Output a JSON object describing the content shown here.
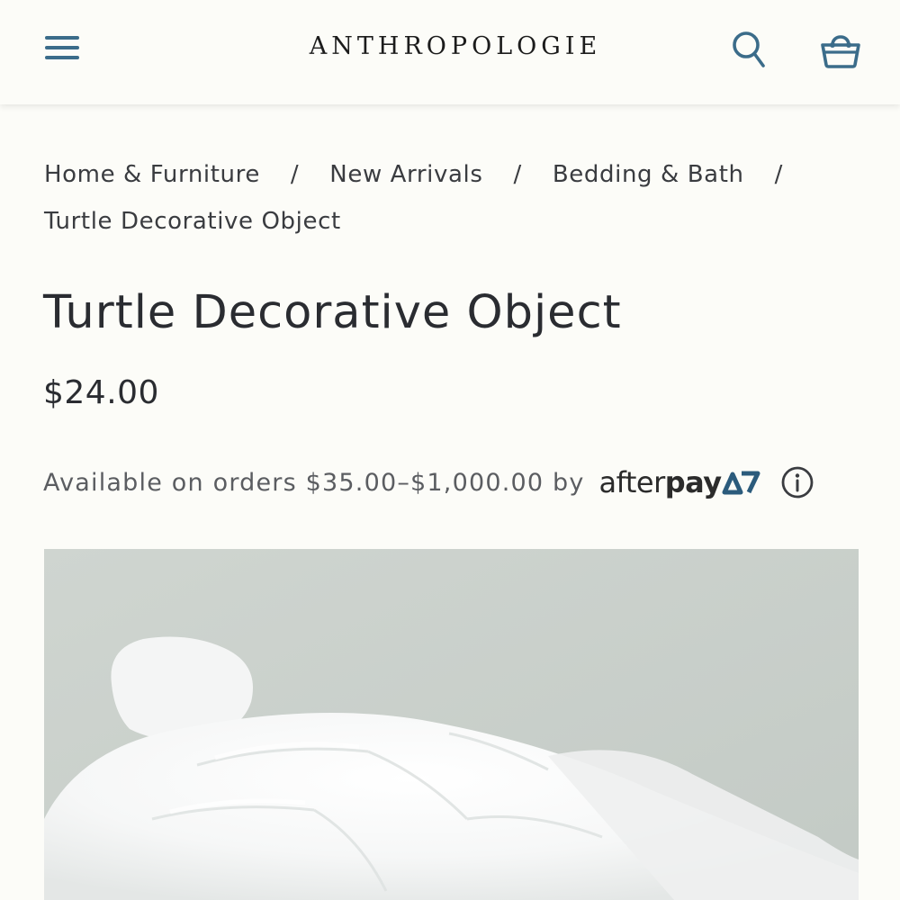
{
  "header": {
    "brand": "ANTHROPOLOGIE",
    "icons": {
      "menu": "hamburger-menu-icon",
      "search": "search-icon",
      "cart": "shopping-basket-icon"
    },
    "accent_color": "#3b6c8a"
  },
  "breadcrumb": {
    "items": [
      {
        "label": "Home & Furniture"
      },
      {
        "label": "New Arrivals"
      },
      {
        "label": "Bedding & Bath"
      },
      {
        "label": "Turtle Decorative Object"
      }
    ],
    "separator": "/"
  },
  "product": {
    "title": "Turtle Decorative Object",
    "price": "$24.00",
    "afterpay": {
      "text": "Available on orders $35.00–$1,000.00 by",
      "logo_light": "after",
      "logo_bold": "pay",
      "info_icon": "info-icon"
    },
    "image": {
      "subject": "white ceramic turtle figurine",
      "background_color": "#c9cfca"
    }
  }
}
